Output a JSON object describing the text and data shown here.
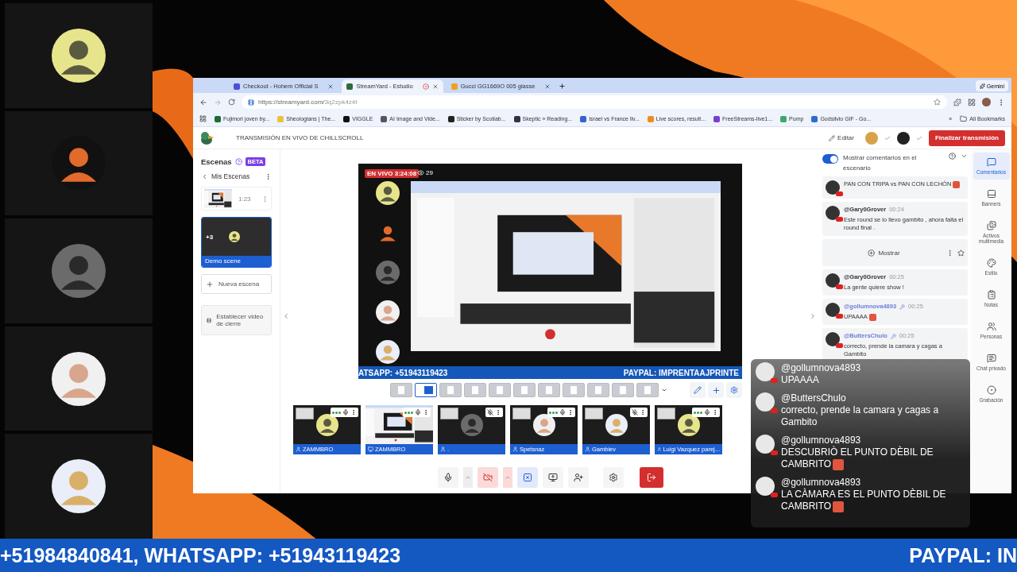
{
  "browser": {
    "tabs": [
      {
        "title": "Checkout - Hohem Official S",
        "selected": false,
        "recording": false
      },
      {
        "title": "StreamYard - Estudio",
        "selected": true,
        "recording": true
      },
      {
        "title": "Gucci GG1669O 005 glasse",
        "selected": false,
        "recording": false
      }
    ],
    "gemini": "Gemini",
    "url_host": "https://streamyard.com/",
    "url_path": "3q2zpk4z4t",
    "bookmarks": [
      "Fujimori joven by...",
      "Sheologians | The...",
      "VIGGLE",
      "AI Image and Vide...",
      "Sticker by Scotiab...",
      "Skeptic » Reading...",
      "Israel vs France liv...",
      "Live scores, result...",
      "FreeStreams-live1...",
      "Pump",
      "Godsilvio GIF - Go..."
    ],
    "more_bookmarks": "»",
    "all_bookmarks": "All Bookmarks"
  },
  "app": {
    "title": "TRANSMISIÓN EN VIVO DE CHILLSCROLL",
    "edit": "Editar",
    "end_button": "Finalizar transmisión"
  },
  "scenes": {
    "heading": "Escenas",
    "badge": "BETA",
    "back": "Mis Escenas",
    "items": [
      {
        "kind": "clip",
        "duration": "1:23",
        "selected": false
      },
      {
        "kind": "scene",
        "label": "Demo scene",
        "count": "+3",
        "selected": true
      }
    ],
    "new_scene": "Nueva escena",
    "closing_video": "Establecer video de cierre"
  },
  "stage": {
    "live": "EN VIVO 3:24:08",
    "viewers": "29",
    "banner_left": "ATSAPP: +51943119423",
    "banner_right": "PAYPAL: IMPRENTAAJPRINTE"
  },
  "layouts": [
    {
      "selected": false
    },
    {
      "selected": true
    },
    {
      "selected": false
    },
    {
      "selected": false
    },
    {
      "selected": false
    },
    {
      "selected": false
    },
    {
      "selected": false
    },
    {
      "selected": false
    },
    {
      "selected": false
    },
    {
      "selected": false
    },
    {
      "selected": false
    }
  ],
  "participants": [
    {
      "kind": "camera",
      "name": "ZAMMBRO",
      "muted": false
    },
    {
      "kind": "screen",
      "name": "ZAMMBRO",
      "muted": false
    },
    {
      "kind": "camera",
      "name": ".",
      "muted": true
    },
    {
      "kind": "camera",
      "name": "Spetsnaz",
      "muted": false
    },
    {
      "kind": "camera",
      "name": "Gambiev",
      "muted": true
    },
    {
      "kind": "camera",
      "name": "Luigi Vazquez parej...",
      "muted": false
    }
  ],
  "controls": {
    "camera_off": true
  },
  "comments": {
    "toggle": {
      "label": "Mostrar comentarios en el escenario",
      "on": true
    },
    "items": [
      {
        "kind": "message",
        "text": "PAN CON TRIPA vs PAN CON LECHÓN",
        "emoji": true
      },
      {
        "kind": "message",
        "author": "@Gary0Grover",
        "time": "00:24",
        "text": "Este round se lo llevo gambito , ahora falta el round final .",
        "moderator": false,
        "emoji": false
      },
      {
        "kind": "hidden",
        "text": "Mostrar"
      },
      {
        "kind": "message",
        "author": "@Gary0Grover",
        "time": "00:25",
        "text": "La gente quiere show !",
        "moderator": false,
        "emoji": false
      },
      {
        "kind": "message",
        "author": "@gollumnova4893",
        "time": "00:25",
        "text": "UPAAAA",
        "moderator": true,
        "emoji": true
      },
      {
        "kind": "message",
        "author": "@ButtersChulo",
        "time": "00:25",
        "text": "correcto, prende la camara y cagas a Gambito",
        "moderator": true,
        "emoji": false
      }
    ]
  },
  "rail": [
    {
      "kind": "comments",
      "label": "Comentarios",
      "selected": true
    },
    {
      "kind": "banners",
      "label": "Banners",
      "selected": false
    },
    {
      "kind": "media",
      "label": "Activos multimedia",
      "selected": false
    },
    {
      "kind": "style",
      "label": "Estilo",
      "selected": false
    },
    {
      "kind": "notes",
      "label": "Notas",
      "selected": false
    },
    {
      "kind": "people",
      "label": "Personas",
      "selected": false
    },
    {
      "kind": "chat",
      "label": "Chat privado",
      "selected": false
    },
    {
      "kind": "recording",
      "label": "Grabación",
      "selected": false
    }
  ],
  "overlay_chat": [
    {
      "author": "@gollumnova4893",
      "text": "UPAAAA",
      "emoji": false
    },
    {
      "author": "@ButtersChulo",
      "text": "correcto, prende la camara y cagas a Gambito",
      "emoji": false
    },
    {
      "author": "@gollumnova4893",
      "text": "DESCUBRIÒ EL PUNTO DÈBIL DE CAMBRITO",
      "emoji": true
    },
    {
      "author": "@gollumnova4893",
      "text": "LA CÀMARA ES EL PUNTO DÈBIL DE CAMBRITO",
      "emoji": true
    }
  ],
  "ticker": {
    "left": "+51984840841, WHATSAPP: +51943119423",
    "right": "PAYPAL: IN"
  }
}
